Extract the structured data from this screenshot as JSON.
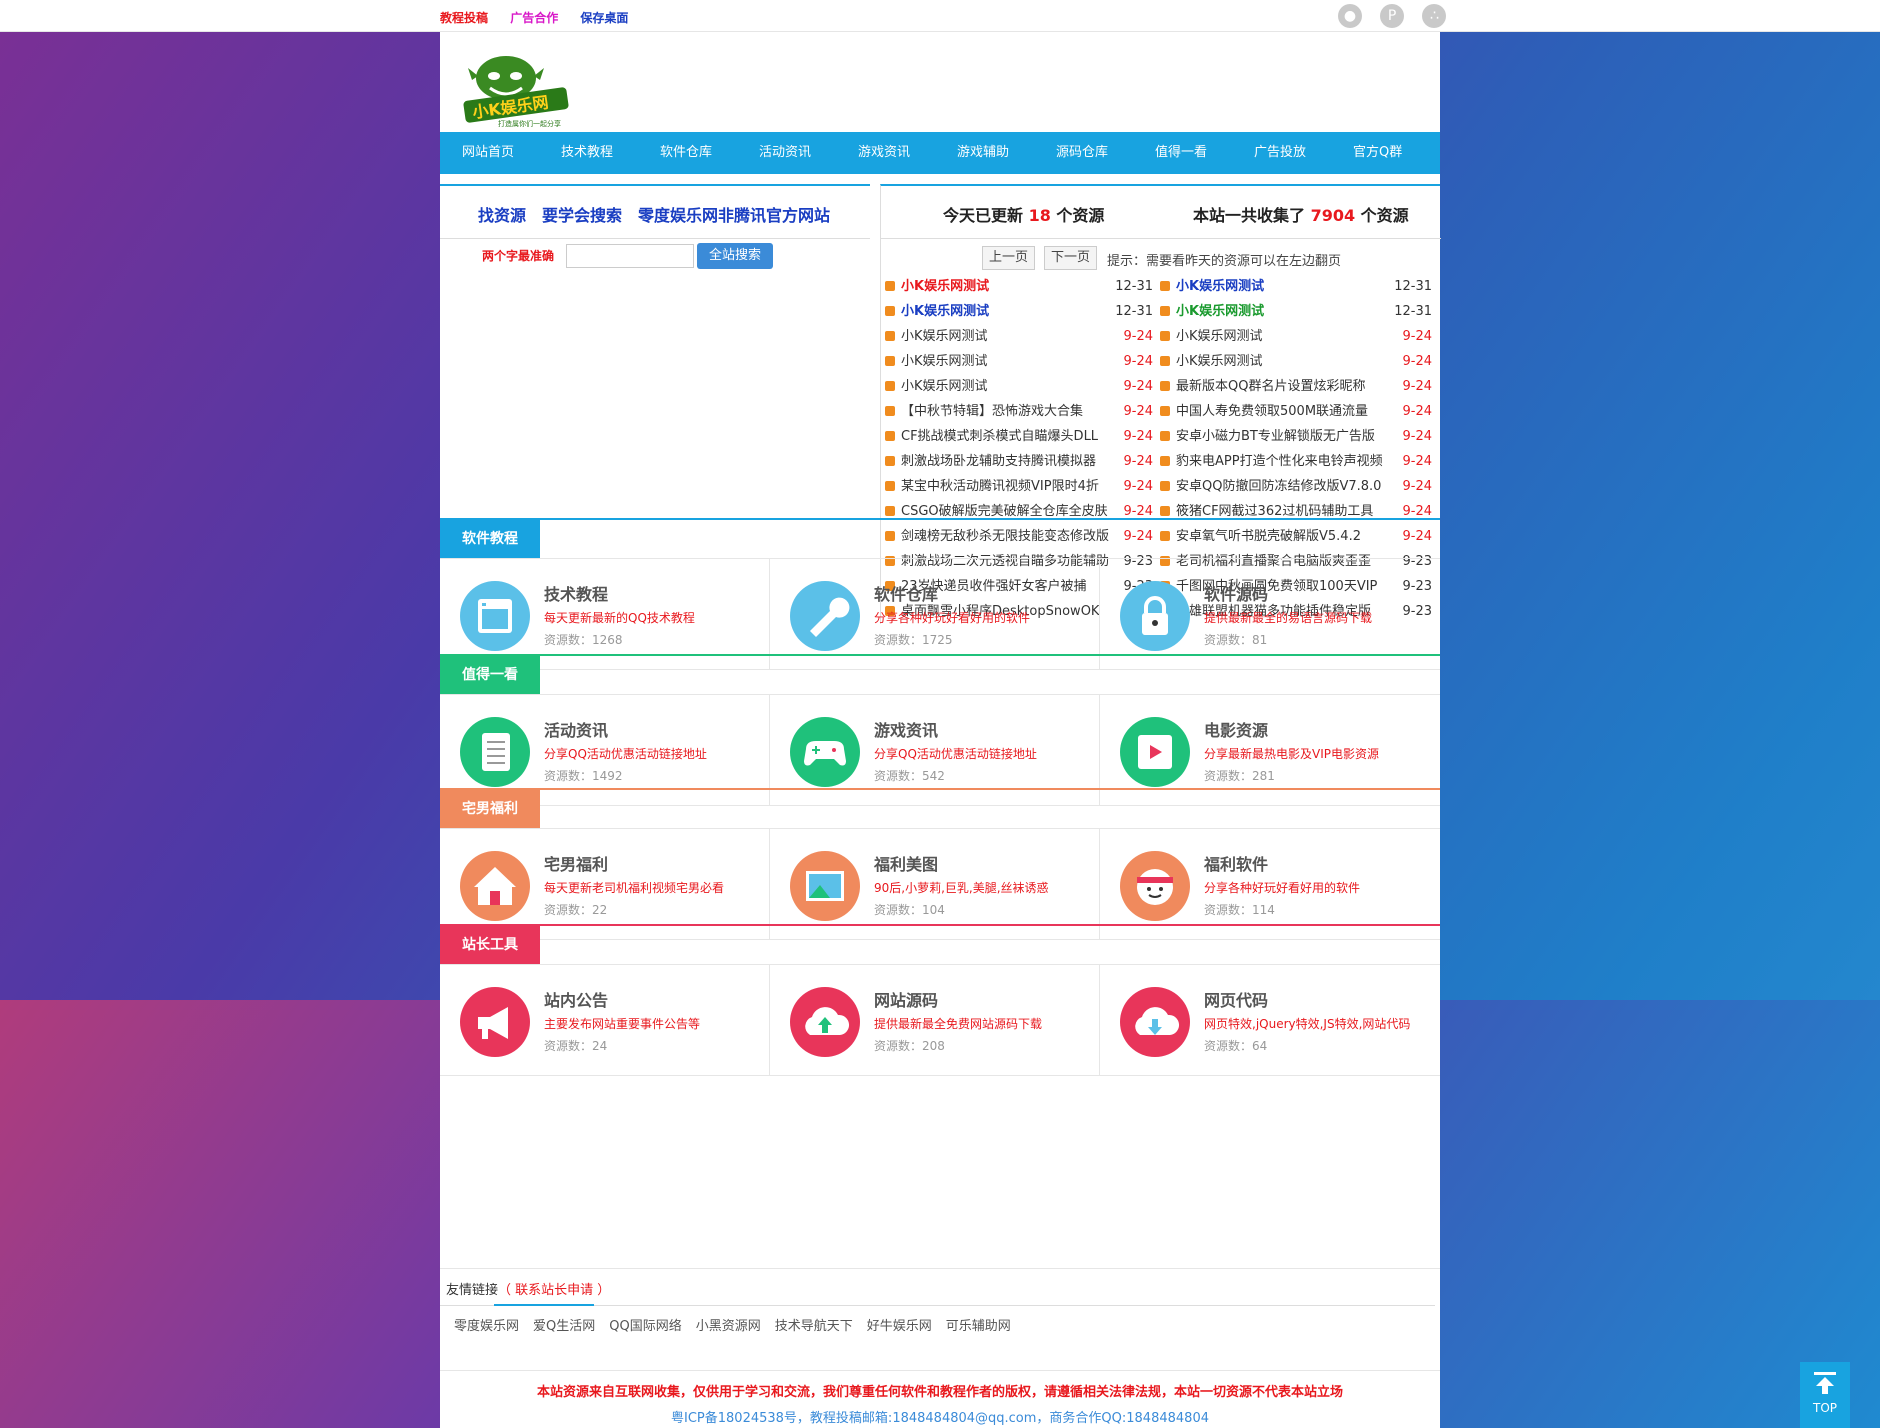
{
  "topbar": {
    "links": [
      {
        "label": "教程投稿",
        "color": "#e8191e"
      },
      {
        "label": "广告合作",
        "color": "#d818c8"
      },
      {
        "label": "保存桌面",
        "color": "#1a3ec2"
      }
    ]
  },
  "logo": {
    "text": "小K娱乐网",
    "tagline": "打造属你们一起分享"
  },
  "nav": [
    "网站首页",
    "技术教程",
    "软件仓库",
    "活动资讯",
    "游戏资讯",
    "游戏辅助",
    "源码仓库",
    "值得一看",
    "广告投放",
    "官方Q群"
  ],
  "search": {
    "slogan": "找资源　要学会搜索　零度娱乐网非腾讯官方网站",
    "hint": "两个字最准确",
    "button": "全站搜索"
  },
  "update": {
    "today_prefix": "今天已更新 ",
    "today_count": "18",
    "today_suffix": " 个资源",
    "total_prefix": "本站一共收集了 ",
    "total_count": "7904",
    "total_suffix": " 个资源",
    "prev": "上一页",
    "next": "下一页",
    "tip": "提示：需要看昨天的资源可以在左边翻页",
    "left": [
      {
        "title": "小K娱乐网测试",
        "date": "12-31",
        "color": "#e8191e",
        "bold": true,
        "datecolor": "#333"
      },
      {
        "title": "小K娱乐网测试",
        "date": "12-31",
        "color": "#1a3ec2",
        "bold": true,
        "datecolor": "#333"
      },
      {
        "title": "小K娱乐网测试",
        "date": "9-24",
        "color": "#333",
        "bold": false
      },
      {
        "title": "小K娱乐网测试",
        "date": "9-24",
        "color": "#333",
        "bold": false
      },
      {
        "title": "小K娱乐网测试",
        "date": "9-24",
        "color": "#333",
        "bold": false
      },
      {
        "title": "【中秋节特辑】恐怖游戏大合集",
        "date": "9-24",
        "color": "#333",
        "bold": false
      },
      {
        "title": "CF挑战模式刺杀模式自瞄爆头DLL",
        "date": "9-24",
        "color": "#333",
        "bold": false
      },
      {
        "title": "刺激战场卧龙辅助支持腾讯模拟器",
        "date": "9-24",
        "color": "#333",
        "bold": false
      },
      {
        "title": "某宝中秋活动腾讯视频VIP限时4折",
        "date": "9-24",
        "color": "#333",
        "bold": false
      },
      {
        "title": "CSGO破解版完美破解全仓库全皮肤",
        "date": "9-24",
        "color": "#333",
        "bold": false
      },
      {
        "title": "剑魂榜无敌秒杀无限技能变态修改版",
        "date": "9-24",
        "color": "#333",
        "bold": false
      },
      {
        "title": "刺激战场二次元透视自瞄多功能辅助",
        "date": "9-23",
        "color": "#333",
        "bold": false,
        "datecolor": "#333"
      },
      {
        "title": "23岁快递员收件强奸女客户被捕",
        "date": "9-23",
        "color": "#333",
        "bold": false,
        "datecolor": "#333"
      },
      {
        "title": "桌面飘雪小程序DesktopSnowOK",
        "date": "9-23",
        "color": "#333",
        "bold": false,
        "datecolor": "#333"
      }
    ],
    "right": [
      {
        "title": "小K娱乐网测试",
        "date": "12-31",
        "color": "#1a3ec2",
        "bold": true,
        "datecolor": "#333"
      },
      {
        "title": "小K娱乐网测试",
        "date": "12-31",
        "color": "#1a9a2e",
        "bold": true,
        "datecolor": "#333"
      },
      {
        "title": "小K娱乐网测试",
        "date": "9-24",
        "color": "#333",
        "bold": false
      },
      {
        "title": "小K娱乐网测试",
        "date": "9-24",
        "color": "#333",
        "bold": false
      },
      {
        "title": "最新版本QQ群名片设置炫彩昵称",
        "date": "9-24",
        "color": "#333",
        "bold": false
      },
      {
        "title": "中国人寿免费领取500M联通流量",
        "date": "9-24",
        "color": "#333",
        "bold": false
      },
      {
        "title": "安卓小磁力BT专业解锁版无广告版",
        "date": "9-24",
        "color": "#333",
        "bold": false
      },
      {
        "title": "豹来电APP打造个性化来电铃声视频",
        "date": "9-24",
        "color": "#333",
        "bold": false
      },
      {
        "title": "安卓QQ防撤回防冻结修改版V7.8.0",
        "date": "9-24",
        "color": "#333",
        "bold": false
      },
      {
        "title": "筱猪CF网截过362过机码辅助工具",
        "date": "9-24",
        "color": "#333",
        "bold": false
      },
      {
        "title": "安卓氧气听书脱壳破解版V5.4.2",
        "date": "9-24",
        "color": "#333",
        "bold": false
      },
      {
        "title": "老司机福利直播聚合电脑版爽歪歪",
        "date": "9-23",
        "color": "#333",
        "bold": false,
        "datecolor": "#333"
      },
      {
        "title": "千图网中秋画圆免费领取100天VIP",
        "date": "9-23",
        "color": "#333",
        "bold": false,
        "datecolor": "#333"
      },
      {
        "title": "英雄联盟机器猫多功能插件稳定版",
        "date": "9-23",
        "color": "#333",
        "bold": false,
        "datecolor": "#333"
      }
    ]
  },
  "sections": [
    {
      "name": "软件教程",
      "color": "#18a3e0",
      "cards": [
        {
          "title": "技术教程",
          "desc": "每天更新最新的QQ技术教程",
          "count": "资源数：1268",
          "icon": "grid-icon",
          "iconcolor": "#5bc0e8"
        },
        {
          "title": "软件仓库",
          "desc": "分享各种好玩好看好用的软件",
          "count": "资源数：1725",
          "icon": "wrench-icon",
          "iconcolor": "#5bc0e8"
        },
        {
          "title": "软件源码",
          "desc": "提供最新最全的易语言源码下载",
          "count": "资源数：81",
          "icon": "lock-icon",
          "iconcolor": "#5bc0e8"
        }
      ]
    },
    {
      "name": "值得一看",
      "color": "#1fc17b",
      "cards": [
        {
          "title": "活动资讯",
          "desc": "分享QQ活动优惠活动链接地址",
          "count": "资源数：1492",
          "icon": "list-icon",
          "iconcolor": "#1fc17b"
        },
        {
          "title": "游戏资讯",
          "desc": "分享QQ活动优惠活动链接地址",
          "count": "资源数：542",
          "icon": "gamepad-icon",
          "iconcolor": "#1fc17b"
        },
        {
          "title": "电影资源",
          "desc": "分享最新最热电影及VIP电影资源",
          "count": "资源数：281",
          "icon": "film-icon",
          "iconcolor": "#1fc17b"
        }
      ]
    },
    {
      "name": "宅男福利",
      "color": "#f08a5d",
      "cards": [
        {
          "title": "宅男福利",
          "desc": "每天更新老司机福利视频宅男必看",
          "count": "资源数：22",
          "icon": "house-icon",
          "iconcolor": "#f08a5d"
        },
        {
          "title": "福利美图",
          "desc": "90后,小萝莉,巨乳,美腿,丝袜诱惑",
          "count": "资源数：104",
          "icon": "picture-icon",
          "iconcolor": "#f08a5d"
        },
        {
          "title": "福利软件",
          "desc": "分享各种好玩好看好用的软件",
          "count": "资源数：114",
          "icon": "face-icon",
          "iconcolor": "#f08a5d"
        }
      ]
    },
    {
      "name": "站长工具",
      "color": "#e8355a",
      "cards": [
        {
          "title": "站内公告",
          "desc": "主要发布网站重要事件公告等",
          "count": "资源数：24",
          "icon": "megaphone-icon",
          "iconcolor": "#e8355a"
        },
        {
          "title": "网站源码",
          "desc": "提供最新最全免费网站源码下载",
          "count": "资源数：208",
          "icon": "cloud-upload-icon",
          "iconcolor": "#e8355a"
        },
        {
          "title": "网页代码",
          "desc": "网页特效,jQuery特效,JS特效,网站代码",
          "count": "资源数：64",
          "icon": "cloud-download-icon",
          "iconcolor": "#e8355a"
        }
      ]
    }
  ],
  "friends": {
    "label": "友情链接",
    "apply": "（ 联系站长申请 ）",
    "links": [
      "零度娱乐网",
      "爱Q生活网",
      "QQ国际网络",
      "小黑资源网",
      "技术导航天下",
      "好牛娱乐网",
      "可乐辅助网"
    ]
  },
  "footer": {
    "line1": "本站资源来自互联网收集，仅供用于学习和交流，我们尊重任何软件和教程作者的版权，请遵循相关法律法规，本站一切资源不代表本站立场",
    "line2": "粤ICP备18024538号，教程投稿邮箱:1848484804@qq.com，商务合作QQ:1848484804"
  },
  "totop": "TOP"
}
